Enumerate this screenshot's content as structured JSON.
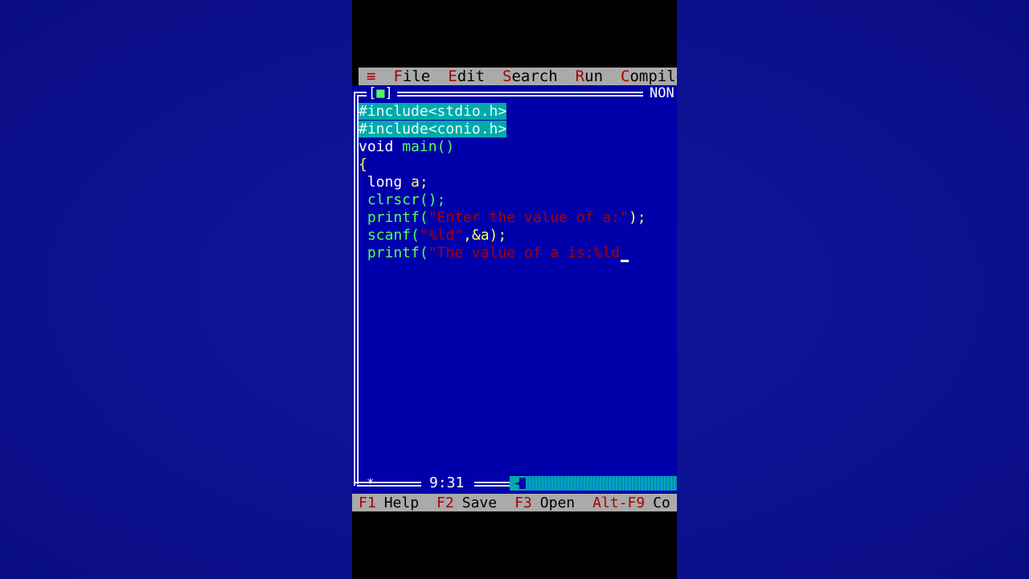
{
  "menu": {
    "system_glyph": "≡",
    "items": [
      {
        "hotkey": "F",
        "rest": "ile"
      },
      {
        "hotkey": "E",
        "rest": "dit"
      },
      {
        "hotkey": "S",
        "rest": "earch"
      },
      {
        "hotkey": "R",
        "rest": "un"
      },
      {
        "hotkey": "C",
        "rest": "ompile"
      }
    ]
  },
  "window": {
    "close_box_left": "[",
    "close_box_glyph": "■",
    "close_box_right": "]",
    "title": "NON"
  },
  "code": {
    "line1": "#include<stdio.h>",
    "line2": "#include<conio.h>",
    "line3_kw": "void",
    "line3_fn": " main()",
    "line4": "{",
    "line5_kw": " long",
    "line5_id": " a;",
    "line6": " clrscr();",
    "line7_fn": " printf(",
    "line7_str": "\"Enter the value of a:\"",
    "line7_end": ");",
    "line8_fn": " scanf(",
    "line8_str": "\"%ld\"",
    "line8_end": ",&a);",
    "line9_fn": " printf(",
    "line9_str": "\"The value of a is:%ld"
  },
  "status": {
    "cursor_position": "9:31",
    "modified_marker": "*"
  },
  "hotkeys": [
    {
      "key": "F1",
      "label": "Help"
    },
    {
      "key": "F2",
      "label": "Save"
    },
    {
      "key": "F3",
      "label": "Open"
    },
    {
      "key": "Alt-F9",
      "label": "Co"
    }
  ],
  "colors": {
    "editor_bg": "#0000aa",
    "menu_bg": "#aaaaaa",
    "hotkey_red": "#aa0000",
    "selection": "#00aaaa"
  }
}
